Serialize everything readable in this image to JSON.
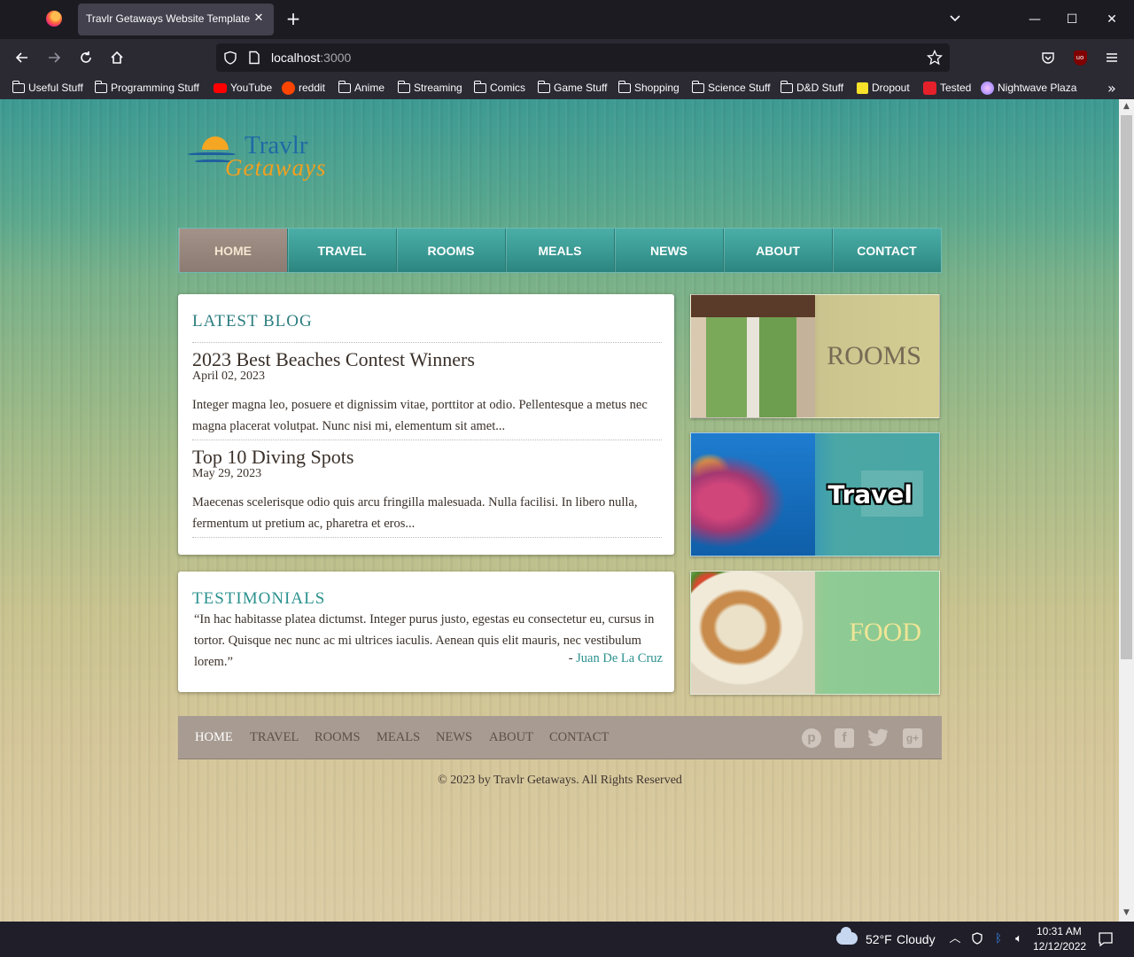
{
  "browser": {
    "tab_title": "Travlr Getaways Website Template",
    "url_host": "localhost",
    "url_port": ":3000",
    "bookmarks": [
      {
        "label": "Useful Stuff",
        "icon": "folder-icon"
      },
      {
        "label": "Programming Stuff",
        "icon": "folder-icon"
      },
      {
        "label": "YouTube",
        "icon": "youtube-icon"
      },
      {
        "label": "reddit",
        "icon": "reddit-icon"
      },
      {
        "label": "Anime",
        "icon": "folder-icon"
      },
      {
        "label": "Streaming",
        "icon": "folder-icon"
      },
      {
        "label": "Comics",
        "icon": "folder-icon"
      },
      {
        "label": "Game Stuff",
        "icon": "folder-icon"
      },
      {
        "label": "Shopping",
        "icon": "folder-icon"
      },
      {
        "label": "Science Stuff",
        "icon": "folder-icon"
      },
      {
        "label": "D&D Stuff",
        "icon": "folder-icon"
      },
      {
        "label": "Dropout",
        "icon": "dropout-icon"
      },
      {
        "label": "Tested",
        "icon": "tested-icon"
      },
      {
        "label": "Nightwave Plaza",
        "icon": "nightwave-icon"
      }
    ]
  },
  "site": {
    "logo_line1": "Travlr",
    "logo_line2": "Getaways",
    "nav": [
      "HOME",
      "TRAVEL",
      "ROOMS",
      "MEALS",
      "NEWS",
      "ABOUT",
      "CONTACT"
    ],
    "nav_active": "HOME",
    "blog": {
      "heading": "LATEST BLOG",
      "posts": [
        {
          "title": "2023 Best Beaches Contest Winners",
          "date": "April 02, 2023",
          "excerpt": "Integer magna leo, posuere et dignissim vitae, porttitor at odio. Pellentesque a metus nec magna placerat volutpat. Nunc nisi mi, elementum sit amet..."
        },
        {
          "title": "Top 10 Diving Spots",
          "date": "May 29, 2023",
          "excerpt": "Maecenas scelerisque odio quis arcu fringilla malesuada. Nulla facilisi. In libero nulla, fermentum ut pretium ac, pharetra et eros..."
        }
      ]
    },
    "testimonials": {
      "heading": "TESTIMONIALS",
      "quote": "“In hac habitasse platea dictumst. Integer purus justo, egestas eu consectetur eu, cursus in tortor. Quisque nec nunc ac mi ultrices iaculis. Aenean quis elit mauris, nec vestibulum lorem.”",
      "author_prefix": "- ",
      "author_name": "Juan De La Cruz"
    },
    "tiles": {
      "rooms": "ROOMS",
      "travel": "Travel",
      "food": "FOOD"
    },
    "footer_nav": [
      "HOME",
      "TRAVEL",
      "ROOMS",
      "MEALS",
      "NEWS",
      "ABOUT",
      "CONTACT"
    ],
    "social": [
      "pinterest-icon",
      "facebook-icon",
      "twitter-icon",
      "google-plus-icon"
    ],
    "copyright": "© 2023 by Travlr Getaways. All Rights Reserved"
  },
  "taskbar": {
    "temperature": "52°F",
    "condition": "Cloudy",
    "time": "10:31 AM",
    "date": "12/12/2022"
  },
  "colors": {
    "nav_teal": "#3a9993",
    "nav_active": "#8b7b72",
    "accent_teal": "#2c7d80",
    "footer_bar": "#a79b92"
  }
}
